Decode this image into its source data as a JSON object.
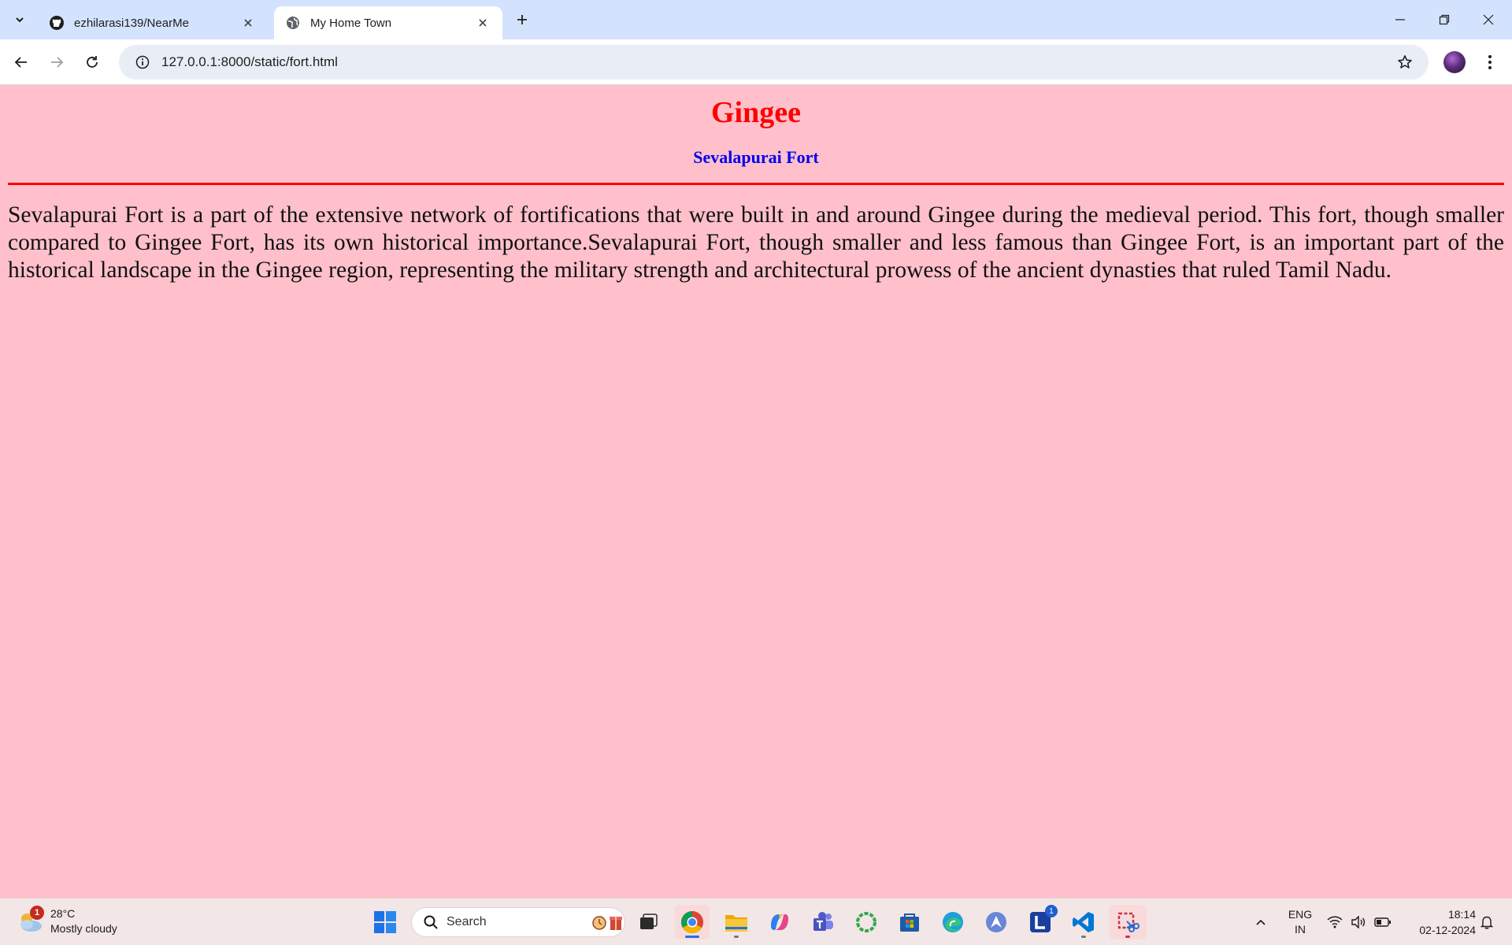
{
  "browser": {
    "tabs": [
      {
        "title": "ezhilarasi139/NearMe",
        "favicon": "github-icon",
        "active": false
      },
      {
        "title": "My Home Town",
        "favicon": "globe-icon",
        "active": true
      }
    ],
    "url": "127.0.0.1:8000/static/fort.html"
  },
  "page": {
    "heading": "Gingee",
    "subheading": "Sevalapurai Fort",
    "paragraph": "Sevalapurai Fort is a part of the extensive network of fortifications that were built in and around Gingee during the medieval period. This fort, though smaller compared to Gingee Fort, has its own historical importance.Sevalapurai Fort, though smaller and less famous than Gingee Fort, is an important part of the historical landscape in the Gingee region, representing the military strength and architectural prowess of the ancient dynasties that ruled Tamil Nadu.",
    "colors": {
      "background": "#ffc0cb",
      "heading": "#ff0000",
      "subheading": "#0000ee",
      "rule": "#ff0000"
    }
  },
  "taskbar": {
    "weather": {
      "badge": "1",
      "temp": "28°C",
      "condition": "Mostly cloudy"
    },
    "search_label": "Search",
    "apps": [
      "task-view",
      "chrome",
      "file-explorer",
      "copilot",
      "teams",
      "app-green-ring",
      "microsoft-store",
      "edge",
      "app-arrow",
      "app-l",
      "vscode",
      "snipping-tool"
    ],
    "app_badges": {
      "app-l": "1"
    },
    "tray": {
      "lang_line1": "ENG",
      "lang_line2": "IN",
      "time": "18:14",
      "date": "02-12-2024"
    }
  }
}
